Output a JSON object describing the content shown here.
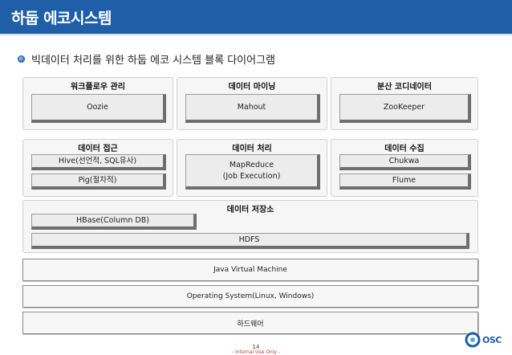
{
  "header": {
    "title": "하둡 에코시스템"
  },
  "subtitle": "빅데이터 처리를 위한 하둡 에코 시스템 블록 다이어그램",
  "panels": {
    "workflow": {
      "title": "워크플로우 관리",
      "items": [
        "Oozie"
      ]
    },
    "mining": {
      "title": "데이터 마이닝",
      "items": [
        "Mahout"
      ]
    },
    "coordinator": {
      "title": "분산 코디네이터",
      "items": [
        "ZooKeeper"
      ]
    },
    "access": {
      "title": "데이터 접근",
      "items": [
        "Hive(선언적, SQL유사)",
        "Pig(절차적)"
      ]
    },
    "processing": {
      "title": "데이터 처리",
      "items": [
        "MapReduce\n(Job Execution)"
      ]
    },
    "collection": {
      "title": "데이터 수집",
      "items": [
        "Chukwa",
        "Flume"
      ]
    },
    "storage": {
      "title": "데이터 저장소",
      "items": [
        "HBase(Column DB)",
        "HDFS"
      ]
    }
  },
  "layers": [
    "Java Virtual Machine",
    "Operating System(Linux, Windows)",
    "하드웨어"
  ],
  "footer": {
    "page_number": "14",
    "confidential": "- Internal Use Only -",
    "logo_text": "OSC"
  },
  "colors": {
    "title_bar": "#1f5fa8",
    "confidential": "#c0392b"
  }
}
